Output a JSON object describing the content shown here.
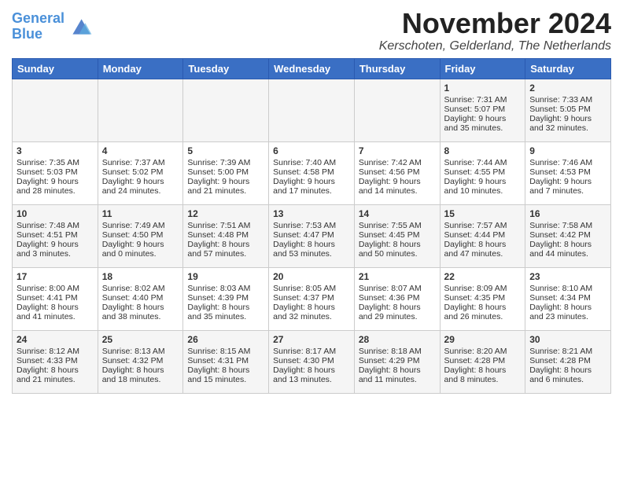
{
  "logo": {
    "line1": "General",
    "line2": "Blue"
  },
  "title": "November 2024",
  "location": "Kerschoten, Gelderland, The Netherlands",
  "days_of_week": [
    "Sunday",
    "Monday",
    "Tuesday",
    "Wednesday",
    "Thursday",
    "Friday",
    "Saturday"
  ],
  "weeks": [
    [
      {
        "day": "",
        "info": ""
      },
      {
        "day": "",
        "info": ""
      },
      {
        "day": "",
        "info": ""
      },
      {
        "day": "",
        "info": ""
      },
      {
        "day": "",
        "info": ""
      },
      {
        "day": "1",
        "info": "Sunrise: 7:31 AM\nSunset: 5:07 PM\nDaylight: 9 hours and 35 minutes."
      },
      {
        "day": "2",
        "info": "Sunrise: 7:33 AM\nSunset: 5:05 PM\nDaylight: 9 hours and 32 minutes."
      }
    ],
    [
      {
        "day": "3",
        "info": "Sunrise: 7:35 AM\nSunset: 5:03 PM\nDaylight: 9 hours and 28 minutes."
      },
      {
        "day": "4",
        "info": "Sunrise: 7:37 AM\nSunset: 5:02 PM\nDaylight: 9 hours and 24 minutes."
      },
      {
        "day": "5",
        "info": "Sunrise: 7:39 AM\nSunset: 5:00 PM\nDaylight: 9 hours and 21 minutes."
      },
      {
        "day": "6",
        "info": "Sunrise: 7:40 AM\nSunset: 4:58 PM\nDaylight: 9 hours and 17 minutes."
      },
      {
        "day": "7",
        "info": "Sunrise: 7:42 AM\nSunset: 4:56 PM\nDaylight: 9 hours and 14 minutes."
      },
      {
        "day": "8",
        "info": "Sunrise: 7:44 AM\nSunset: 4:55 PM\nDaylight: 9 hours and 10 minutes."
      },
      {
        "day": "9",
        "info": "Sunrise: 7:46 AM\nSunset: 4:53 PM\nDaylight: 9 hours and 7 minutes."
      }
    ],
    [
      {
        "day": "10",
        "info": "Sunrise: 7:48 AM\nSunset: 4:51 PM\nDaylight: 9 hours and 3 minutes."
      },
      {
        "day": "11",
        "info": "Sunrise: 7:49 AM\nSunset: 4:50 PM\nDaylight: 9 hours and 0 minutes."
      },
      {
        "day": "12",
        "info": "Sunrise: 7:51 AM\nSunset: 4:48 PM\nDaylight: 8 hours and 57 minutes."
      },
      {
        "day": "13",
        "info": "Sunrise: 7:53 AM\nSunset: 4:47 PM\nDaylight: 8 hours and 53 minutes."
      },
      {
        "day": "14",
        "info": "Sunrise: 7:55 AM\nSunset: 4:45 PM\nDaylight: 8 hours and 50 minutes."
      },
      {
        "day": "15",
        "info": "Sunrise: 7:57 AM\nSunset: 4:44 PM\nDaylight: 8 hours and 47 minutes."
      },
      {
        "day": "16",
        "info": "Sunrise: 7:58 AM\nSunset: 4:42 PM\nDaylight: 8 hours and 44 minutes."
      }
    ],
    [
      {
        "day": "17",
        "info": "Sunrise: 8:00 AM\nSunset: 4:41 PM\nDaylight: 8 hours and 41 minutes."
      },
      {
        "day": "18",
        "info": "Sunrise: 8:02 AM\nSunset: 4:40 PM\nDaylight: 8 hours and 38 minutes."
      },
      {
        "day": "19",
        "info": "Sunrise: 8:03 AM\nSunset: 4:39 PM\nDaylight: 8 hours and 35 minutes."
      },
      {
        "day": "20",
        "info": "Sunrise: 8:05 AM\nSunset: 4:37 PM\nDaylight: 8 hours and 32 minutes."
      },
      {
        "day": "21",
        "info": "Sunrise: 8:07 AM\nSunset: 4:36 PM\nDaylight: 8 hours and 29 minutes."
      },
      {
        "day": "22",
        "info": "Sunrise: 8:09 AM\nSunset: 4:35 PM\nDaylight: 8 hours and 26 minutes."
      },
      {
        "day": "23",
        "info": "Sunrise: 8:10 AM\nSunset: 4:34 PM\nDaylight: 8 hours and 23 minutes."
      }
    ],
    [
      {
        "day": "24",
        "info": "Sunrise: 8:12 AM\nSunset: 4:33 PM\nDaylight: 8 hours and 21 minutes."
      },
      {
        "day": "25",
        "info": "Sunrise: 8:13 AM\nSunset: 4:32 PM\nDaylight: 8 hours and 18 minutes."
      },
      {
        "day": "26",
        "info": "Sunrise: 8:15 AM\nSunset: 4:31 PM\nDaylight: 8 hours and 15 minutes."
      },
      {
        "day": "27",
        "info": "Sunrise: 8:17 AM\nSunset: 4:30 PM\nDaylight: 8 hours and 13 minutes."
      },
      {
        "day": "28",
        "info": "Sunrise: 8:18 AM\nSunset: 4:29 PM\nDaylight: 8 hours and 11 minutes."
      },
      {
        "day": "29",
        "info": "Sunrise: 8:20 AM\nSunset: 4:28 PM\nDaylight: 8 hours and 8 minutes."
      },
      {
        "day": "30",
        "info": "Sunrise: 8:21 AM\nSunset: 4:28 PM\nDaylight: 8 hours and 6 minutes."
      }
    ]
  ]
}
